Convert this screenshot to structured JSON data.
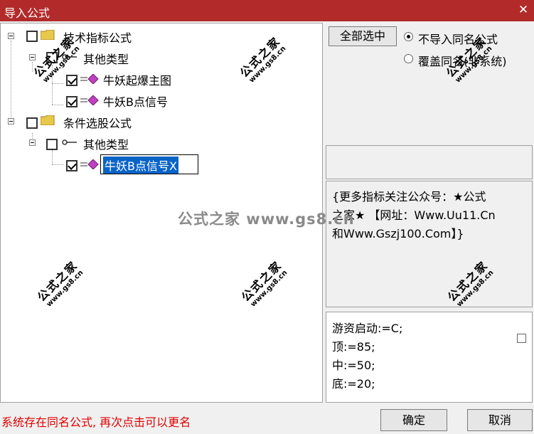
{
  "window": {
    "title": "导入公式",
    "close_glyph": "✕"
  },
  "tree": {
    "root1": {
      "label": "技术指标公式",
      "checked": false
    },
    "root1_child": {
      "label": "其他类型",
      "checked": false
    },
    "root1_items": [
      {
        "label": "牛妖起爆主图",
        "checked": true
      },
      {
        "label": "牛妖B点信号",
        "checked": true
      }
    ],
    "root2": {
      "label": "条件选股公式",
      "checked": false
    },
    "root2_child": {
      "label": "其他类型",
      "checked": false
    },
    "root2_items": [
      {
        "label": "牛妖B点信号X",
        "checked": true,
        "selected": true
      }
    ]
  },
  "right": {
    "select_all": "全部选中",
    "options": [
      {
        "label": "不导入同名公式",
        "selected": true
      },
      {
        "label": "覆盖同名(非系统)",
        "selected": false
      }
    ],
    "description": [
      "{更多指标关注公众号：★公式",
      "之家★ 【网址：Www.Uu11.Cn",
      "和Www.Gszj100.Com】}"
    ],
    "code": [
      "游资启动:=C;",
      "顶:=85;",
      "中:=50;",
      "底:=20;"
    ]
  },
  "footer": {
    "status": "系统存在同名公式, 再次点击可以更名",
    "ok": "确定",
    "cancel": "取消"
  },
  "watermark": {
    "big": "公式之家",
    "small": "www.gs8.cn",
    "center": "公式之家 www.gs8.cn"
  },
  "colors": {
    "titlebar": "#b22a2a",
    "selection": "#0a64c8",
    "status": "#e00000"
  }
}
